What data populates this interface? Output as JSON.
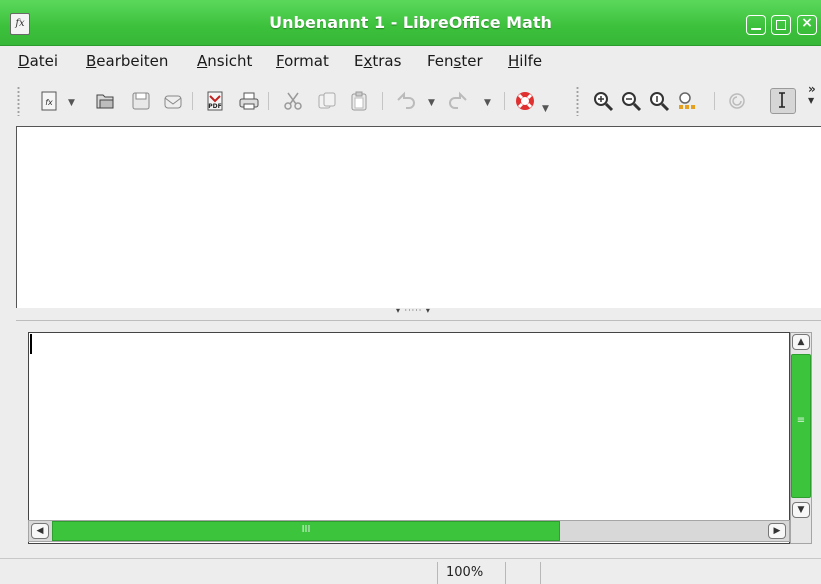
{
  "window": {
    "title": "Unbenannt 1 - LibreOffice Math",
    "app_icon": "math-document-icon",
    "accent": "#3cc13c",
    "buttons": [
      "minimize-icon",
      "maximize-icon",
      "close-icon"
    ]
  },
  "menu": {
    "items": [
      {
        "pre": "",
        "key": "D",
        "post": "atei"
      },
      {
        "pre": "",
        "key": "B",
        "post": "earbeiten"
      },
      {
        "pre": "",
        "key": "A",
        "post": "nsicht"
      },
      {
        "pre": "",
        "key": "F",
        "post": "ormat"
      },
      {
        "pre": "E",
        "key": "x",
        "post": "tras"
      },
      {
        "pre": "Fen",
        "key": "s",
        "post": "ter"
      },
      {
        "pre": "",
        "key": "H",
        "post": "ilfe"
      }
    ]
  },
  "toolbar": {
    "icons": [
      "new-document-icon",
      "open-icon",
      "save-icon",
      "email-icon",
      "export-pdf-icon",
      "print-icon",
      "cut-icon",
      "copy-icon",
      "paste-icon",
      "undo-icon",
      "redo-icon",
      "help-icon",
      "zoom-in-icon",
      "zoom-out-icon",
      "zoom-100-icon",
      "show-all-icon",
      "update-icon",
      "formula-cursor-icon"
    ],
    "overflow": "»"
  },
  "command": {
    "text": "",
    "hscroll_grip": "III",
    "vscroll_grip": "≡"
  },
  "status": {
    "zoom": "100%"
  }
}
